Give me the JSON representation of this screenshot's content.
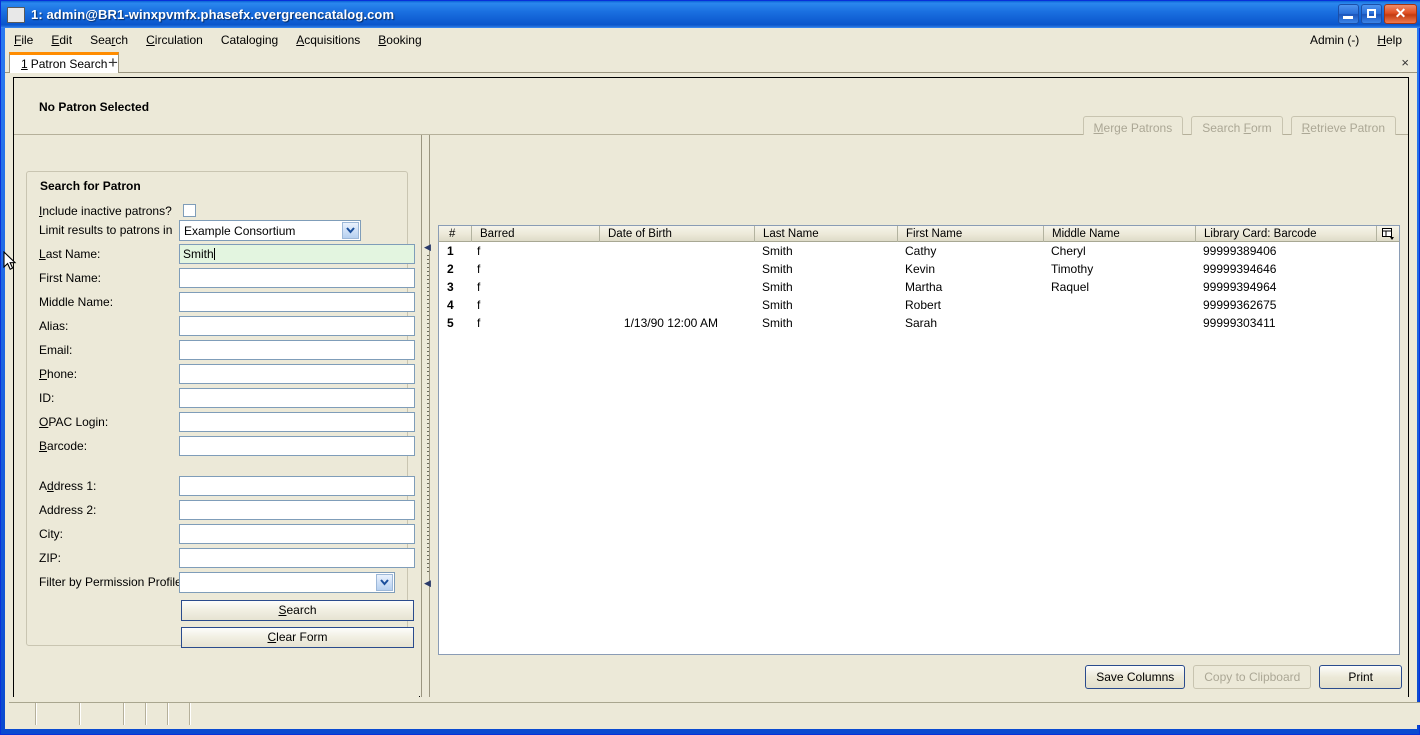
{
  "window": {
    "title": "1: admin@BR1-winxpvmfx.phasefx.evergreencatalog.com",
    "icon": "app-icon",
    "minimize_label": "Minimize",
    "maximize_label": "Maximize",
    "close_label": "Close"
  },
  "menubar": {
    "items": [
      {
        "label": "File",
        "accel": "F"
      },
      {
        "label": "Edit",
        "accel": "E"
      },
      {
        "label": "Search",
        "accel": "r"
      },
      {
        "label": "Circulation",
        "accel": "C"
      },
      {
        "label": "Cataloging",
        "accel": "g"
      },
      {
        "label": "Acquisitions",
        "accel": "A"
      },
      {
        "label": "Booking",
        "accel": "B"
      }
    ],
    "right": [
      {
        "label": "Admin (-)",
        "accel": ""
      },
      {
        "label": "Help",
        "accel": "H"
      }
    ]
  },
  "tabs": {
    "active": {
      "number": "1",
      "label": "Patron Search"
    },
    "new_tab_label": "+",
    "close_label": "×"
  },
  "patron_header": {
    "title": "No Patron Selected",
    "buttons": [
      {
        "label": "Merge Patrons",
        "enabled": false
      },
      {
        "label": "Search Form",
        "enabled": false
      },
      {
        "label": "Retrieve Patron",
        "enabled": false
      }
    ]
  },
  "search_form": {
    "legend": "Search for Patron",
    "fields": [
      {
        "label": "Include inactive patrons?",
        "type": "checkbox",
        "value": "",
        "checked": false
      },
      {
        "label": "Limit results to patrons in",
        "type": "select",
        "value": "Example Consortium"
      },
      {
        "label": "Last Name:",
        "type": "text",
        "value": "Smith",
        "focused": true
      },
      {
        "label": "First Name:",
        "type": "text",
        "value": ""
      },
      {
        "label": "Middle Name:",
        "type": "text",
        "value": ""
      },
      {
        "label": "Alias:",
        "type": "text",
        "value": ""
      },
      {
        "label": "Email:",
        "type": "text",
        "value": ""
      },
      {
        "label": "Phone:",
        "type": "text",
        "value": ""
      },
      {
        "label": "ID:",
        "type": "text",
        "value": ""
      },
      {
        "label": "OPAC Login:",
        "type": "text",
        "value": ""
      },
      {
        "label": "Barcode:",
        "type": "text",
        "value": ""
      },
      {
        "label": "Address 1:",
        "type": "text",
        "value": ""
      },
      {
        "label": "Address 2:",
        "type": "text",
        "value": ""
      },
      {
        "label": "City:",
        "type": "text",
        "value": ""
      },
      {
        "label": "ZIP:",
        "type": "text",
        "value": ""
      },
      {
        "label": "Filter by Permission Profile:",
        "type": "select",
        "value": ""
      }
    ],
    "search_button": "Search",
    "clear_button": "Clear Form"
  },
  "results": {
    "columns": [
      "#",
      "Barred",
      "Date of Birth",
      "Last Name",
      "First Name",
      "Middle Name",
      "Library Card: Barcode"
    ],
    "rows": [
      {
        "num": "1",
        "barred": "f",
        "dob": "",
        "last": "Smith",
        "first": "Cathy",
        "middle": "Cheryl",
        "barcode": "99999389406"
      },
      {
        "num": "2",
        "barred": "f",
        "dob": "",
        "last": "Smith",
        "first": "Kevin",
        "middle": "Timothy",
        "barcode": "99999394646"
      },
      {
        "num": "3",
        "barred": "f",
        "dob": "",
        "last": "Smith",
        "first": "Martha",
        "middle": "Raquel",
        "barcode": "99999394964"
      },
      {
        "num": "4",
        "barred": "f",
        "dob": "",
        "last": "Smith",
        "first": "Robert",
        "middle": "",
        "barcode": "99999362675"
      },
      {
        "num": "5",
        "barred": "f",
        "dob": "1/13/90 12:00 AM",
        "last": "Smith",
        "first": "Sarah",
        "middle": "",
        "barcode": "99999303411"
      }
    ],
    "column_picker_icon": "column-picker-icon",
    "footer_buttons": [
      {
        "label": "Save Columns",
        "enabled": true
      },
      {
        "label": "Copy to Clipboard",
        "enabled": false
      },
      {
        "label": "Print",
        "enabled": true
      }
    ]
  },
  "statusbar": {
    "cells": [
      "",
      "",
      "",
      "",
      "",
      "",
      ""
    ]
  },
  "colors": {
    "titlebar_blue": "#0a54d6",
    "face": "#ece9d8",
    "focus_field_green": "#e3f5e0",
    "tab_accent_orange": "#ff8c00",
    "field_border": "#7f9db9"
  }
}
